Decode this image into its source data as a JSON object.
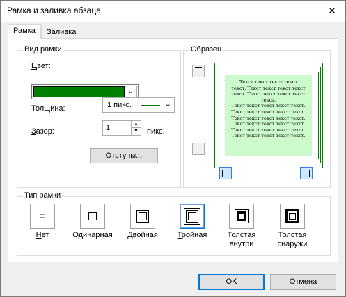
{
  "window": {
    "title": "Рамка и заливка абзаца",
    "close_glyph": "✕"
  },
  "tabs": [
    {
      "label": "Рамка",
      "active": true
    },
    {
      "label": "Заливка",
      "active": false
    }
  ],
  "frame_view": {
    "legend": "Вид рамки",
    "color_label": "Цвет:",
    "color_value": "#008000",
    "thickness_label": "Толщина:",
    "thickness_value": "1 пикс.",
    "gap_label": "Зазор:",
    "gap_value": "1",
    "gap_unit": "пикс.",
    "indents_button": "Отступы..."
  },
  "sample": {
    "legend": "Образец",
    "preview_lines": [
      "Текст текст текст текст",
      "текст. Текст текст текст текст",
      "текст. Текст текст текст текст",
      "текст.",
      "Текст текст текст текст текст.",
      "Текст текст текст текст текст.",
      "Текст текст текст текст текст.",
      "Текст текст текст текст текст.",
      "Текст текст текст текст текст.",
      "Текст текст текст текст текст."
    ],
    "preview_bg": "#ccfacc"
  },
  "frame_type": {
    "legend": "Тип рамки",
    "options": [
      {
        "label": "Нет"
      },
      {
        "label": "Одинарная"
      },
      {
        "label": "Двойная"
      },
      {
        "label": "Тройная",
        "selected": true
      },
      {
        "label": "Толстая внутри"
      },
      {
        "label": "Толстая снаружи"
      }
    ]
  },
  "buttons": {
    "ok": "OK",
    "cancel": "Отмена"
  },
  "colors": {
    "accent": "#0078d7",
    "frame_green": "#008000"
  }
}
